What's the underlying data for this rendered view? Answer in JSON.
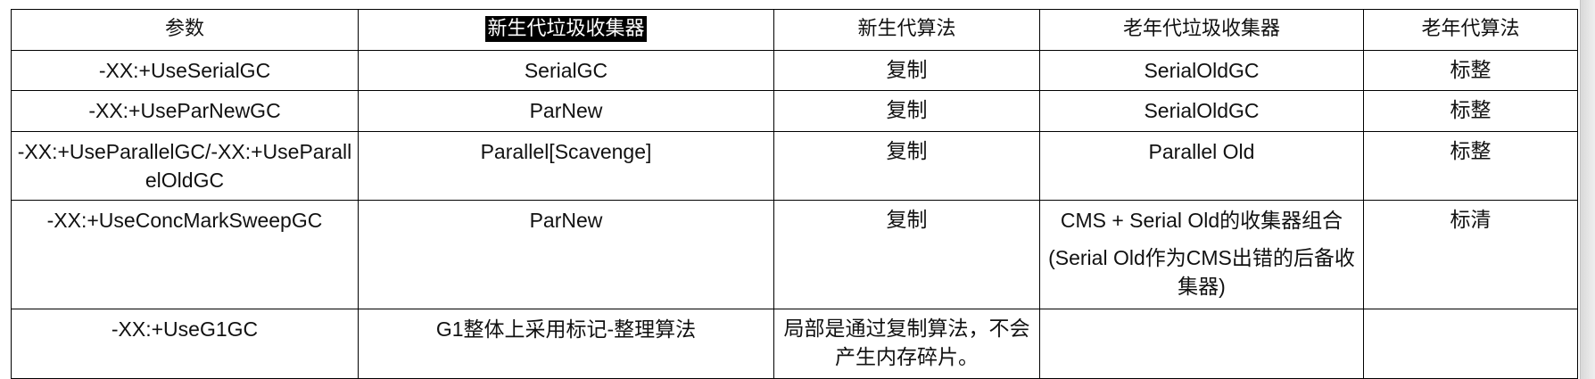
{
  "table": {
    "headers": [
      "参数",
      "新生代垃圾收集器",
      "新生代算法",
      "老年代垃圾收集器",
      "老年代算法"
    ],
    "rows": [
      {
        "param": "-XX:+UseSerialGC",
        "young_collector": "SerialGC",
        "young_algorithm": "复制",
        "old_collector": "SerialOldGC",
        "old_algorithm": "标整"
      },
      {
        "param": "-XX:+UseParNewGC",
        "young_collector": "ParNew",
        "young_algorithm": "复制",
        "old_collector": "SerialOldGC",
        "old_algorithm": "标整"
      },
      {
        "param": "-XX:+UseParallelGC/-XX:+UseParallelOldGC",
        "young_collector": "Parallel[Scavenge]",
        "young_algorithm": "复制",
        "old_collector": "Parallel Old",
        "old_algorithm": "标整"
      },
      {
        "param": "-XX:+UseConcMarkSweepGC",
        "young_collector": "ParNew",
        "young_algorithm": "复制",
        "old_collector": "CMS + Serial Old的收集器组合",
        "old_collector_note": "(Serial Old作为CMS出错的后备收集器)",
        "old_algorithm": "标清"
      },
      {
        "param": "-XX:+UseG1GC",
        "young_collector": "G1整体上采用标记-整理算法",
        "young_algorithm": "局部是通过复制算法，不会产生内存碎片。",
        "old_collector": "",
        "old_algorithm": ""
      }
    ]
  }
}
